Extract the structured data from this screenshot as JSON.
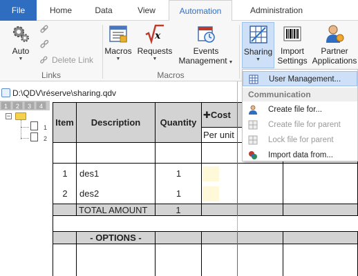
{
  "ribbon": {
    "tabs": [
      "File",
      "Home",
      "Data",
      "View",
      "Automation",
      "Administration"
    ],
    "active_tab": "Automation",
    "buttons": {
      "auto": "Auto",
      "delete_link": "Delete Link",
      "macros": "Macros",
      "requests": "Requests",
      "events": "Events",
      "management": "Management",
      "sharing": "Sharing",
      "import": "Import",
      "settings": "Settings",
      "partner": "Partner",
      "applications": "Applications"
    },
    "groups": {
      "links": "Links",
      "macros": "Macros"
    }
  },
  "document": {
    "path": "D:\\QDV\\réserve\\sharing.qdv",
    "levels": [
      "1",
      "2",
      "3",
      "4"
    ],
    "tree_numbers": [
      "1",
      "2"
    ]
  },
  "table": {
    "headers": {
      "item": "Item",
      "description": "Description",
      "quantity": "Quantity",
      "cost": "Cost",
      "per_unit": "Per unit"
    },
    "rows": [
      {
        "item": "1",
        "description": "des1",
        "quantity": "1"
      },
      {
        "item": "2",
        "description": "des2",
        "quantity": "1"
      }
    ],
    "total_label": "TOTAL AMOUNT",
    "total_quantity": "1",
    "options_label": "- OPTIONS -"
  },
  "sharing_menu": {
    "user_management": "User Management...",
    "section": "Communication",
    "items": [
      {
        "label": "Create file for...",
        "enabled": true
      },
      {
        "label": "Create file for parent",
        "enabled": false
      },
      {
        "label": "Lock file for parent",
        "enabled": false
      },
      {
        "label": "Import data from...",
        "enabled": true
      }
    ]
  }
}
